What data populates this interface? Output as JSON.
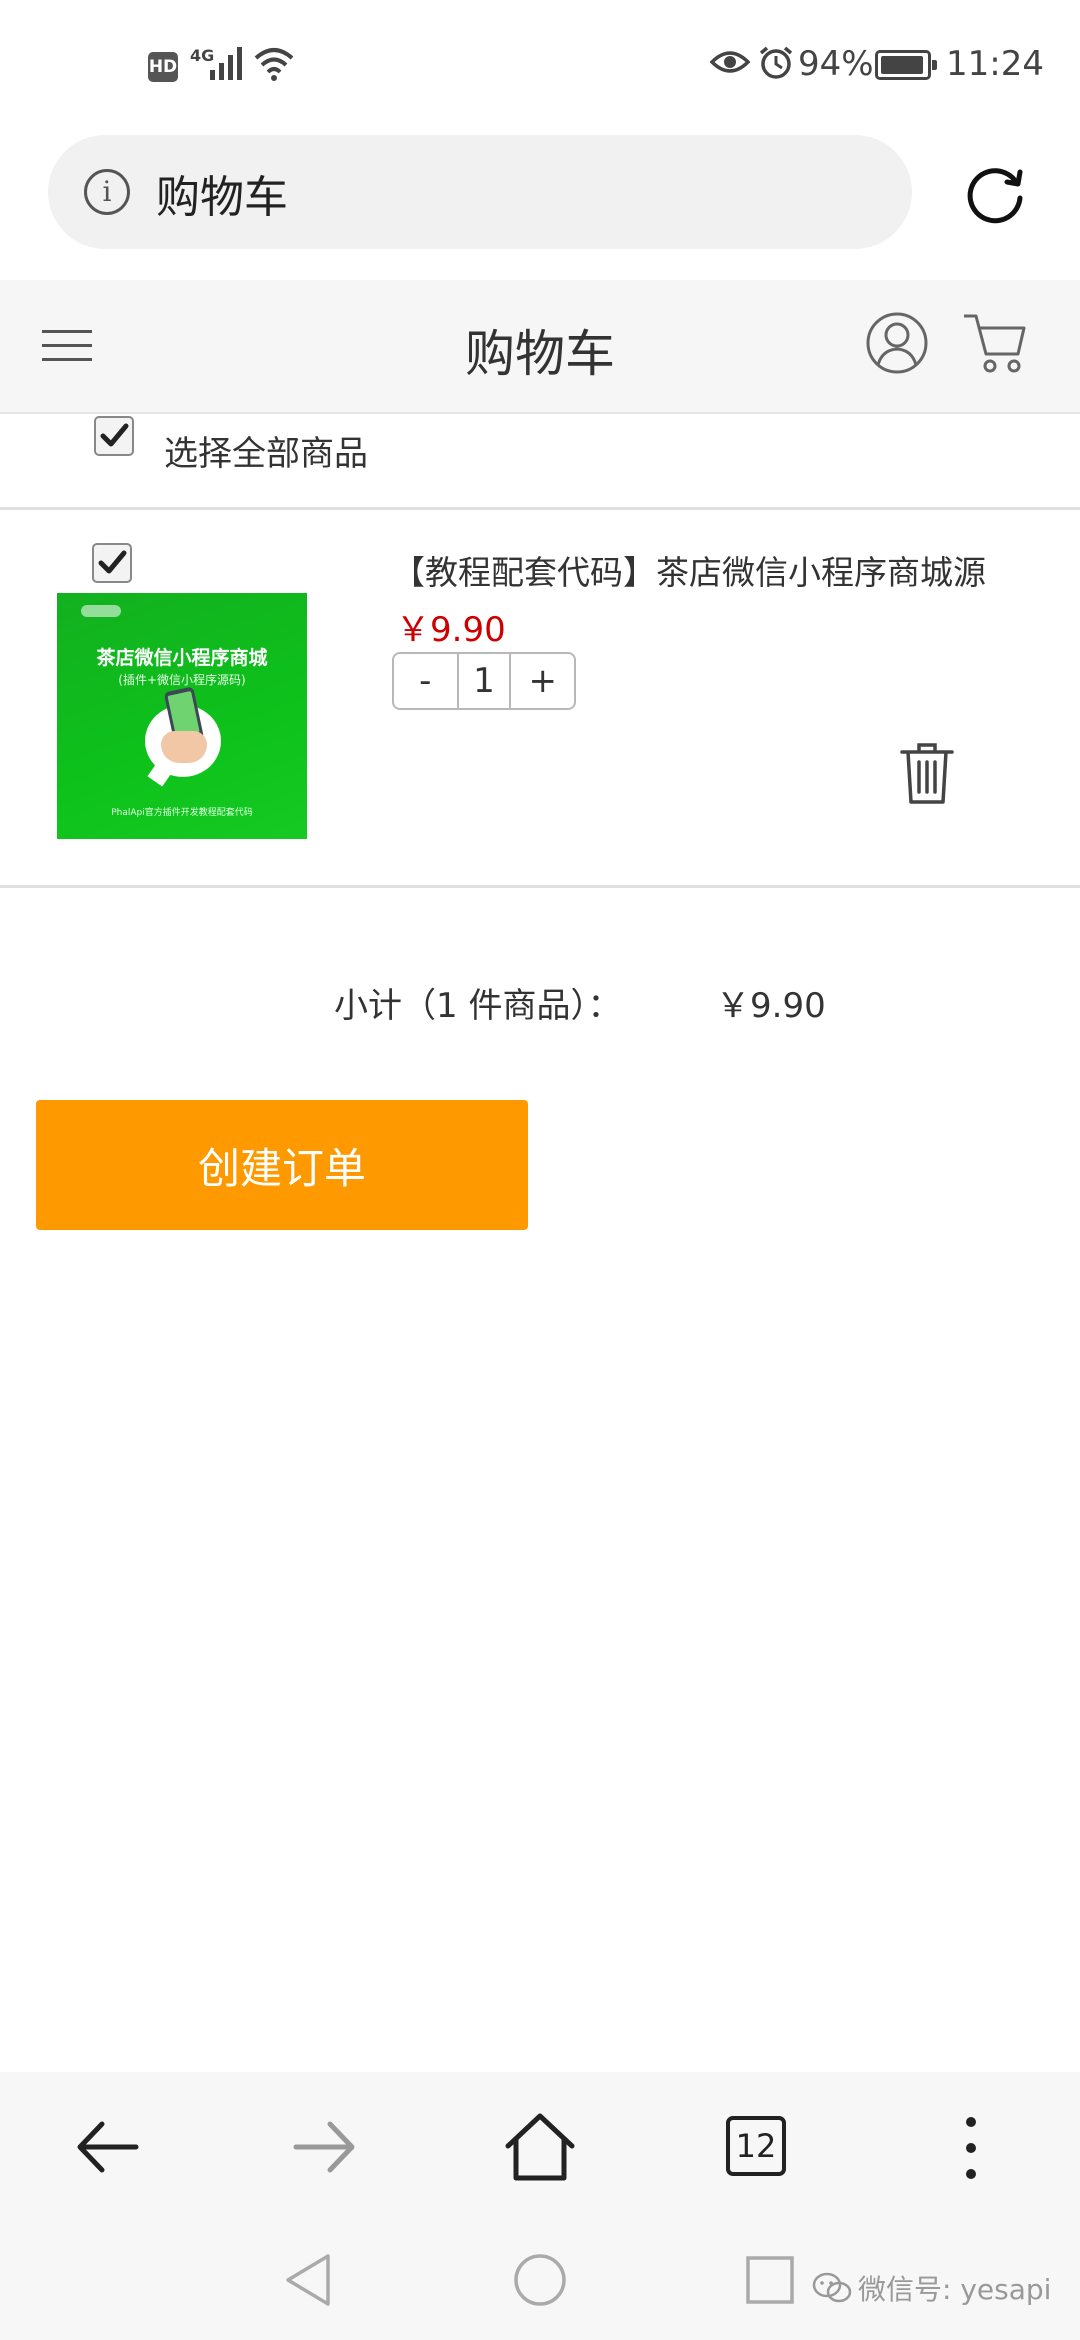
{
  "status_bar": {
    "hd_badge": "HD",
    "network": "4G",
    "battery_percent": "94%",
    "time": "11:24"
  },
  "address_bar": {
    "page_title": "购物车"
  },
  "header": {
    "title": "购物车"
  },
  "cart": {
    "select_all_label": "选择全部商品",
    "select_all_checked": true,
    "items": [
      {
        "checked": true,
        "title": "【教程配套代码】茶店微信小程序商城源",
        "price": "￥9.90",
        "quantity": "1",
        "decrement_label": "-",
        "increment_label": "+",
        "image": {
          "title": "茶店微信小程序商城",
          "subtitle": "(插件+微信小程序源码)",
          "footer": "PhalApi官方插件开发教程配套代码"
        }
      }
    ],
    "subtotal_label": "小计（1 件商品）：",
    "subtotal_value": "￥9.90",
    "order_button_label": "创建订单"
  },
  "browser_toolbar": {
    "tab_count": "12"
  },
  "watermark": {
    "text": "微信号: yesapi"
  },
  "colors": {
    "accent_orange": "#ff9900",
    "price_red": "#cc0000",
    "product_green": "#13b020"
  }
}
